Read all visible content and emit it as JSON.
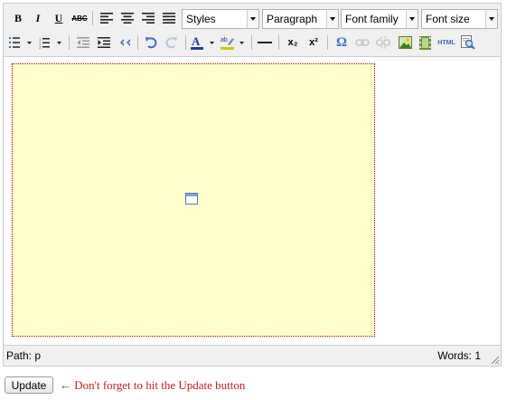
{
  "toolbar": {
    "bold_label": "B",
    "italic_label": "I",
    "underline_label": "U",
    "strike_label": "ABC",
    "styles_select": "Styles",
    "format_select": "Paragraph",
    "fontfamily_select": "Font family",
    "fontsize_select": "Font size",
    "subscript_label": "x₂",
    "superscript_label": "x²",
    "charmap_label": "Ω",
    "html_label": "HTML",
    "colors": {
      "text_color": "#1f3f9a",
      "highlight_color": "#c8c800",
      "icon_blue": "#3a6fc4"
    }
  },
  "icons": {
    "row1": [
      "bold-icon",
      "italic-icon",
      "underline-icon",
      "strikethrough-icon",
      "align-left-icon",
      "align-center-icon",
      "align-right-icon",
      "align-justify-icon"
    ],
    "row2": [
      "bullet-list-icon",
      "numbered-list-icon",
      "outdent-icon",
      "indent-icon",
      "blockquote-icon",
      "undo-icon",
      "redo-icon",
      "text-color-icon",
      "highlight-color-icon",
      "horizontal-rule-icon",
      "subscript-icon",
      "superscript-icon",
      "charmap-icon",
      "link-icon",
      "unlink-icon",
      "image-icon",
      "media-icon",
      "html-source-icon",
      "preview-icon"
    ]
  },
  "editor": {
    "placeholder_bg": "#ffffcc",
    "placeholder_border": "#c00000"
  },
  "status": {
    "path": "Path: p",
    "words": "Words: 1"
  },
  "footer": {
    "update_button": "Update",
    "note": "← Don't forget to hit the Update button"
  }
}
